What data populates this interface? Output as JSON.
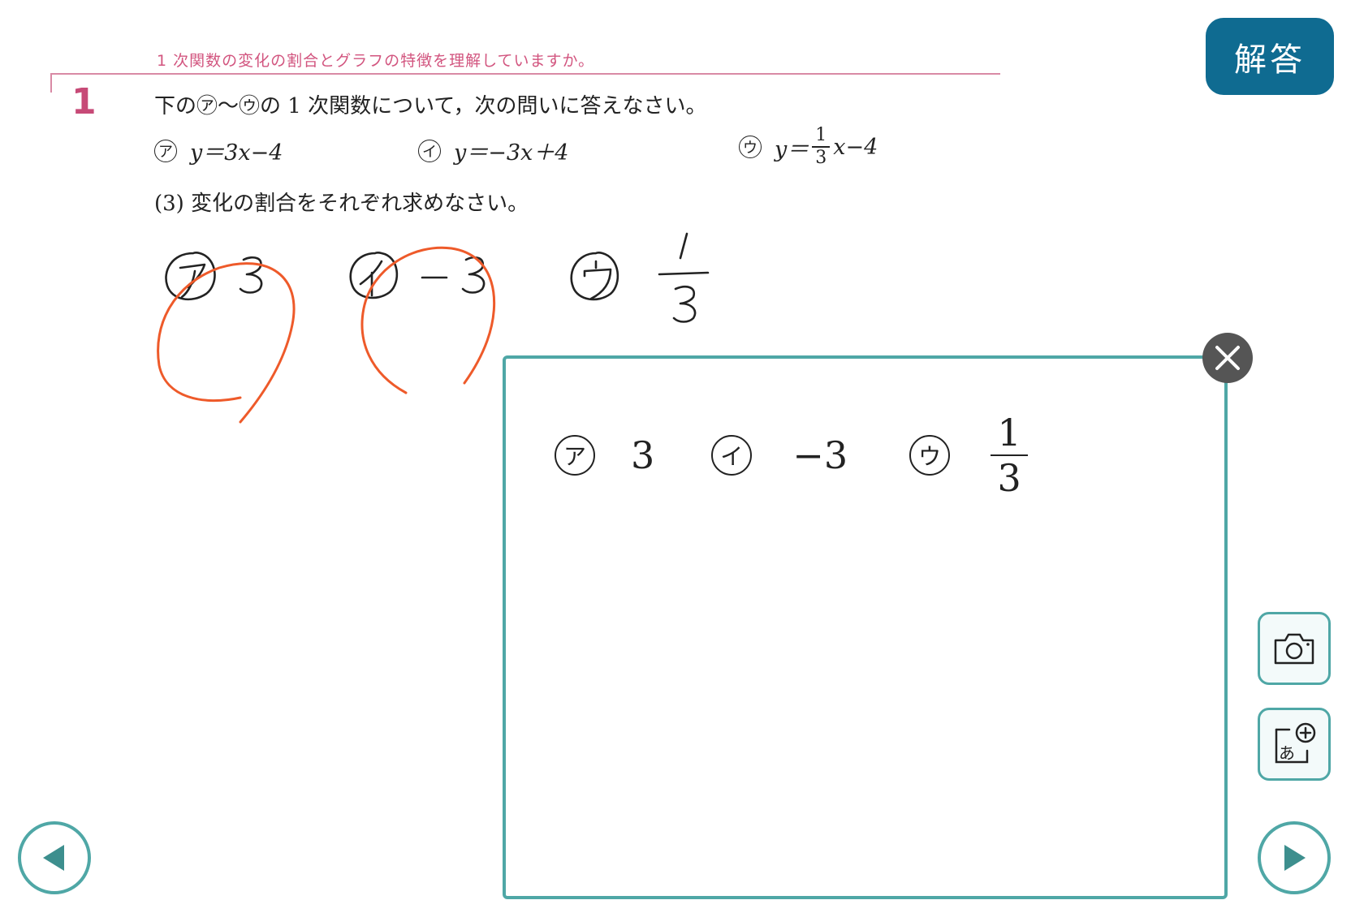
{
  "header": {
    "section_title": "1 次関数の変化の割合とグラフの特徴を理解していますか。",
    "question_number": "1",
    "question_text": "下の㋐〜㋒の 1 次関数について，次の問いに答えなさい。"
  },
  "equations": [
    {
      "mark": "ア",
      "expr": "y＝3x−4"
    },
    {
      "mark": "イ",
      "expr": "y＝−3x＋4"
    },
    {
      "mark": "ウ",
      "expr_prefix": "y＝",
      "frac_num": "1",
      "frac_den": "3",
      "expr_suffix": "x−4"
    }
  ],
  "subquestion": "(3)  変化の割合をそれぞれ求めなさい。",
  "answer_button_label": "解答",
  "answer_panel": {
    "items": [
      {
        "mark": "ア",
        "value": "3"
      },
      {
        "mark": "イ",
        "value": "−3"
      },
      {
        "mark": "ウ",
        "frac_num": "1",
        "frac_den": "3"
      }
    ]
  },
  "icons": {
    "close": "close-icon",
    "camera": "camera-icon",
    "add_text": "add-text-icon",
    "prev": "prev-arrow-icon",
    "next": "next-arrow-icon"
  },
  "colors": {
    "accent_teal": "#4fa7a6",
    "answer_button": "#0f6b91",
    "section_pink": "#d2557f",
    "correct_mark": "#ee5a2a"
  }
}
